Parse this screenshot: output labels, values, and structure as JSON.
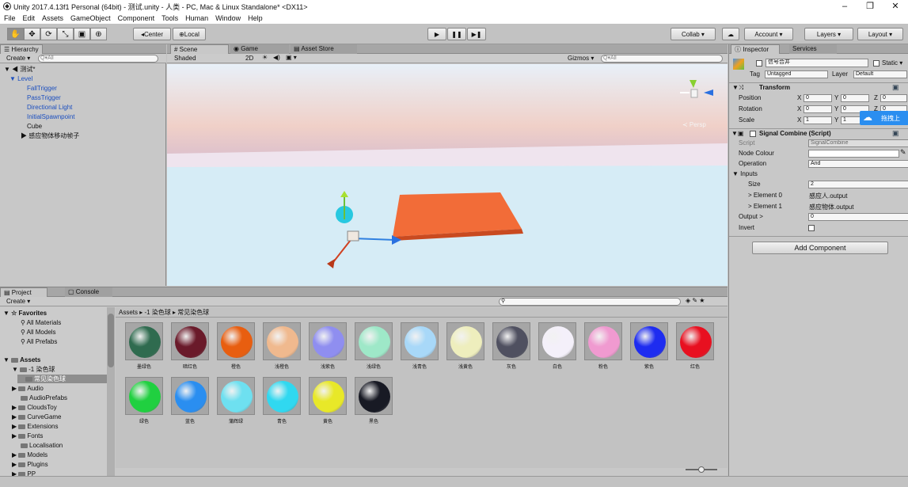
{
  "window": {
    "title": "Unity 2017.4.13f1 Personal (64bit) - 测试.unity - 人类 - PC, Mac & Linux Standalone* <DX11>",
    "minimize": "–",
    "maximize": "❐",
    "close": "✕"
  },
  "menu": [
    "File",
    "Edit",
    "Assets",
    "GameObject",
    "Component",
    "Tools",
    "Human",
    "Window",
    "Help"
  ],
  "toolbar": {
    "tools": [
      "✋",
      "✥",
      "⟳",
      "⤡",
      "▣",
      "⊕"
    ],
    "pivot": "Center",
    "space": "Local",
    "play": "▶",
    "pause": "❚❚",
    "step": "▶❚",
    "collab": "Collab ▾",
    "cloud": "☁",
    "account": "Account ▾",
    "layers": "Layers ▾",
    "layout": "Layout ▾"
  },
  "hierarchy": {
    "tab": "Hierarchy",
    "create": "Create ▾",
    "search_placeholder": "Q▾All",
    "scene": "测试*",
    "root": "Level",
    "items": [
      "FallTrigger",
      "PassTrigger",
      "Directional Light",
      "InitialSpawnpoint",
      "Cube",
      "感应物体移动帧子"
    ]
  },
  "scene_view": {
    "tabs": [
      "Scene",
      "Game",
      "Asset Store"
    ],
    "shading": "Shaded",
    "mode2d": "2D",
    "gizmos": "Gizmos ▾",
    "search_placeholder": "Q▾All",
    "persp_label": "≺ Persp"
  },
  "inspector": {
    "tabs": [
      "Inspector",
      "Services"
    ],
    "object_name": "信号合并",
    "static_label": "Static ▾",
    "tag_label": "Tag",
    "tag_value": "Untagged",
    "layer_label": "Layer",
    "layer_value": "Default",
    "transform": {
      "title": "Transform",
      "position_label": "Position",
      "rotation_label": "Rotation",
      "scale_label": "Scale",
      "position": [
        "0",
        "0",
        "0"
      ],
      "rotation": [
        "0",
        "0",
        "0"
      ],
      "scale": [
        "1",
        "1",
        ""
      ]
    },
    "script": {
      "title": "Signal Combine (Script)",
      "script_label": "Script",
      "script_value": "SignalCombine",
      "node_colour_label": "Node Colour",
      "operation_label": "Operation",
      "operation_value": "And",
      "inputs_label": "Inputs",
      "size_label": "Size",
      "size_value": "2",
      "element0_label": "> Element 0",
      "element0_value": "感应人.output",
      "element1_label": "> Element 1",
      "element1_value": "感应物体.output",
      "output_label": "Output >",
      "output_value": "0",
      "invert_label": "Invert"
    },
    "add_component": "Add Component",
    "cloud_overlay": "拖拽上"
  },
  "project": {
    "tabs": [
      "Project",
      "Console"
    ],
    "create": "Create ▾",
    "favorites_label": "Favorites",
    "favorites": [
      "All Materials",
      "All Models",
      "All Prefabs"
    ],
    "assets_label": "Assets",
    "folders": [
      "-1 染色球",
      "常见染色球",
      "Audio",
      "AudioPrefabs",
      "CloudsToy",
      "CurveGame",
      "Extensions",
      "Fonts",
      "Localisation",
      "Models",
      "Plugins",
      "PP"
    ],
    "breadcrumb": [
      "Assets",
      "-1 染色球",
      "常见染色球"
    ],
    "materials": [
      {
        "name": "墨绿色",
        "color": "#2f6b4f"
      },
      {
        "name": "暗红色",
        "color": "#6a1a2a"
      },
      {
        "name": "橙色",
        "color": "#e85e10"
      },
      {
        "name": "浅橙色",
        "color": "#f0b98e"
      },
      {
        "name": "浅紫色",
        "color": "#8f8ef0"
      },
      {
        "name": "浅绿色",
        "color": "#9ee8c8"
      },
      {
        "name": "浅青色",
        "color": "#a8d8f8"
      },
      {
        "name": "浅黄色",
        "color": "#eeeebd"
      },
      {
        "name": "灰色",
        "color": "#4f5060"
      },
      {
        "name": "白色",
        "color": "#f4f0fa"
      },
      {
        "name": "粉色",
        "color": "#f09ad0"
      },
      {
        "name": "紫色",
        "color": "#1e2cf0"
      },
      {
        "name": "红色",
        "color": "#e81020"
      },
      {
        "name": "绿色",
        "color": "#20d040"
      },
      {
        "name": "蓝色",
        "color": "#2a8ef0"
      },
      {
        "name": "蒲辉绿",
        "color": "#6ee0f0"
      },
      {
        "name": "青色",
        "color": "#30d8f0"
      },
      {
        "name": "黄色",
        "color": "#e8e828"
      },
      {
        "name": "黑色",
        "color": "#181a24"
      }
    ]
  }
}
